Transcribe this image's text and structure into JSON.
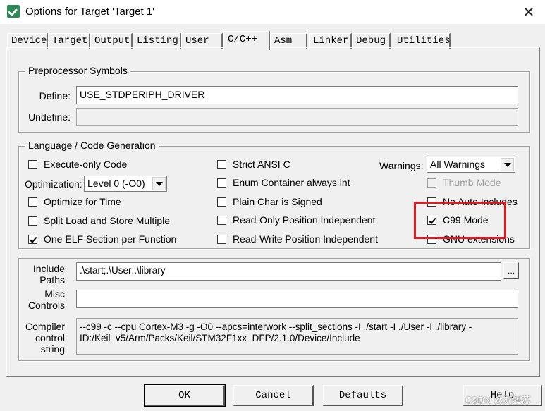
{
  "window": {
    "title": "Options for Target 'Target 1'",
    "close": "✕"
  },
  "tabs": [
    "Device",
    "Target",
    "Output",
    "Listing",
    "User",
    "C/C++",
    "Asm",
    "Linker",
    "Debug",
    "Utilities"
  ],
  "active_tab": "C/C++",
  "preprocessor": {
    "group_title": "Preprocessor Symbols",
    "define_label": "Define:",
    "define_value": "USE_STDPERIPH_DRIVER",
    "undefine_label": "Undefine:",
    "undefine_value": ""
  },
  "language": {
    "group_title": "Language / Code Generation",
    "execute_only": {
      "label": "Execute-only Code",
      "checked": false
    },
    "optimization_label": "Optimization:",
    "optimization_value": "Level 0 (-O0)",
    "optimize_time": {
      "label": "Optimize for Time",
      "checked": false
    },
    "split_load": {
      "label": "Split Load and Store Multiple",
      "checked": false
    },
    "one_elf": {
      "label": "One ELF Section per Function",
      "checked": true
    },
    "strict_ansi": {
      "label": "Strict ANSI C",
      "checked": false
    },
    "enum_int": {
      "label": "Enum Container always int",
      "checked": false
    },
    "plain_char": {
      "label": "Plain Char is Signed",
      "checked": false
    },
    "ro_pos": {
      "label": "Read-Only Position Independent",
      "checked": false
    },
    "rw_pos": {
      "label": "Read-Write Position Independent",
      "checked": false
    },
    "warnings_label": "Warnings:",
    "warnings_value": "All Warnings",
    "thumb_mode": {
      "label": "Thumb Mode",
      "checked": false
    },
    "no_auto_includes": {
      "label": "No Auto Includes",
      "checked": false
    },
    "c99_mode": {
      "label": "C99 Mode",
      "checked": true
    },
    "gnu_ext": {
      "label": "GNU extensions",
      "checked": false
    }
  },
  "paths": {
    "include_label_1": "Include",
    "include_label_2": "Paths",
    "include_value": ".\\start;.\\User;.\\library",
    "browse": "...",
    "misc_label_1": "Misc",
    "misc_label_2": "Controls",
    "misc_value": "",
    "compiler_label_1": "Compiler",
    "compiler_label_2": "control",
    "compiler_label_3": "string",
    "compiler_value": "--c99 -c --cpu Cortex-M3 -g -O0 --apcs=interwork --split_sections -I ./start -I ./User -I ./library -ID:/Keil_v5/Arm/Packs/Keil/STM32F1xx_DFP/2.1.0/Device/Include"
  },
  "buttons": {
    "ok": "OK",
    "cancel": "Cancel",
    "defaults": "Defaults",
    "help": "Help"
  },
  "watermark": "CSDN @刘墨苏",
  "colors": {
    "highlight": "#e01b24",
    "background": "#f0f0f0"
  }
}
